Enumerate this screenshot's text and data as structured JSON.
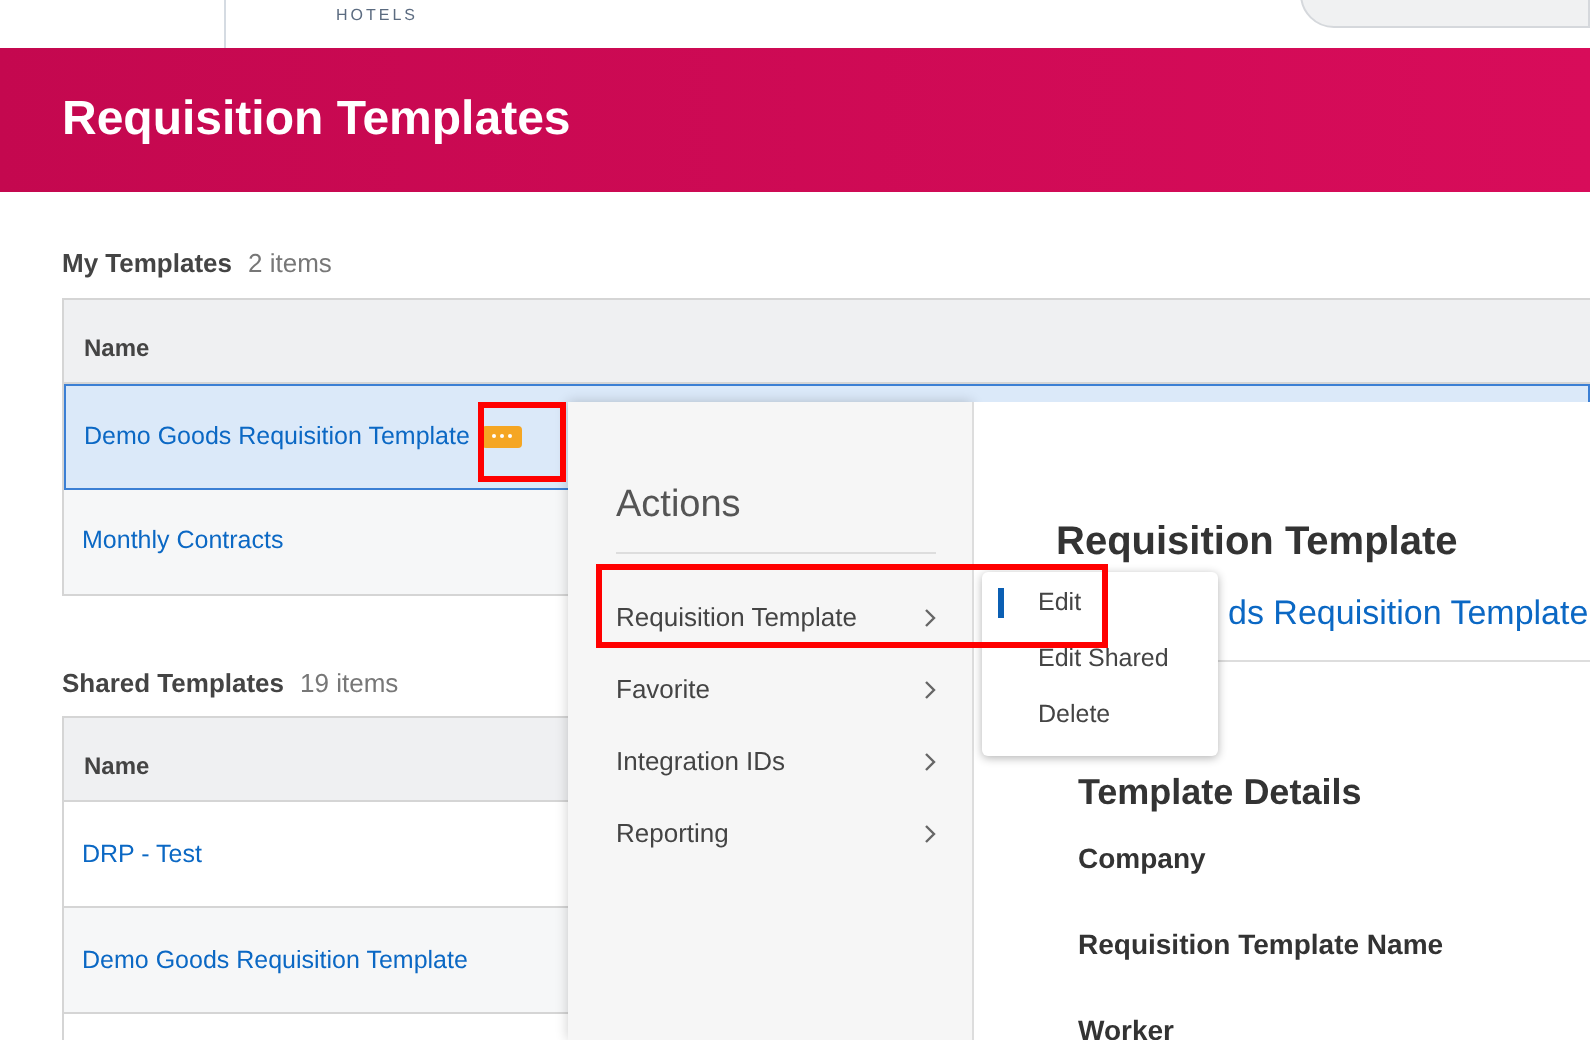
{
  "header": {
    "brand_text": "HOTELS"
  },
  "banner": {
    "title": "Requisition Templates"
  },
  "sections": [
    {
      "title": "My Templates",
      "count": "2 items",
      "column": "Name",
      "rows": [
        {
          "name": "Demo Goods Requisition Template",
          "selected": true,
          "related_actions": true,
          "annotated": true
        },
        {
          "name": "Monthly Contracts",
          "selected": false,
          "related_actions": false,
          "annotated": false
        }
      ]
    },
    {
      "title": "Shared Templates",
      "count": "19 items",
      "column": "Name",
      "rows": [
        {
          "name": "DRP - Test",
          "selected": false,
          "related_actions": false,
          "annotated": false
        },
        {
          "name": "Demo Goods Requisition Template",
          "selected": false,
          "related_actions": false,
          "annotated": false
        }
      ]
    }
  ],
  "actions_menu": {
    "title": "Actions",
    "items": [
      {
        "label": "Requisition Template",
        "annotated": true
      },
      {
        "label": "Favorite",
        "annotated": false
      },
      {
        "label": "Integration IDs",
        "annotated": false
      },
      {
        "label": "Reporting",
        "annotated": false
      }
    ]
  },
  "submenu": {
    "items": [
      {
        "label": "Edit",
        "selected": true
      },
      {
        "label": "Edit Shared",
        "selected": false
      },
      {
        "label": "Delete",
        "selected": false
      }
    ]
  },
  "details": {
    "title": "Requisition Template",
    "link": "ds Requisition Template",
    "section_title": "Template Details",
    "fields": [
      "Company",
      "Requisition Template Name",
      "Worker"
    ]
  }
}
